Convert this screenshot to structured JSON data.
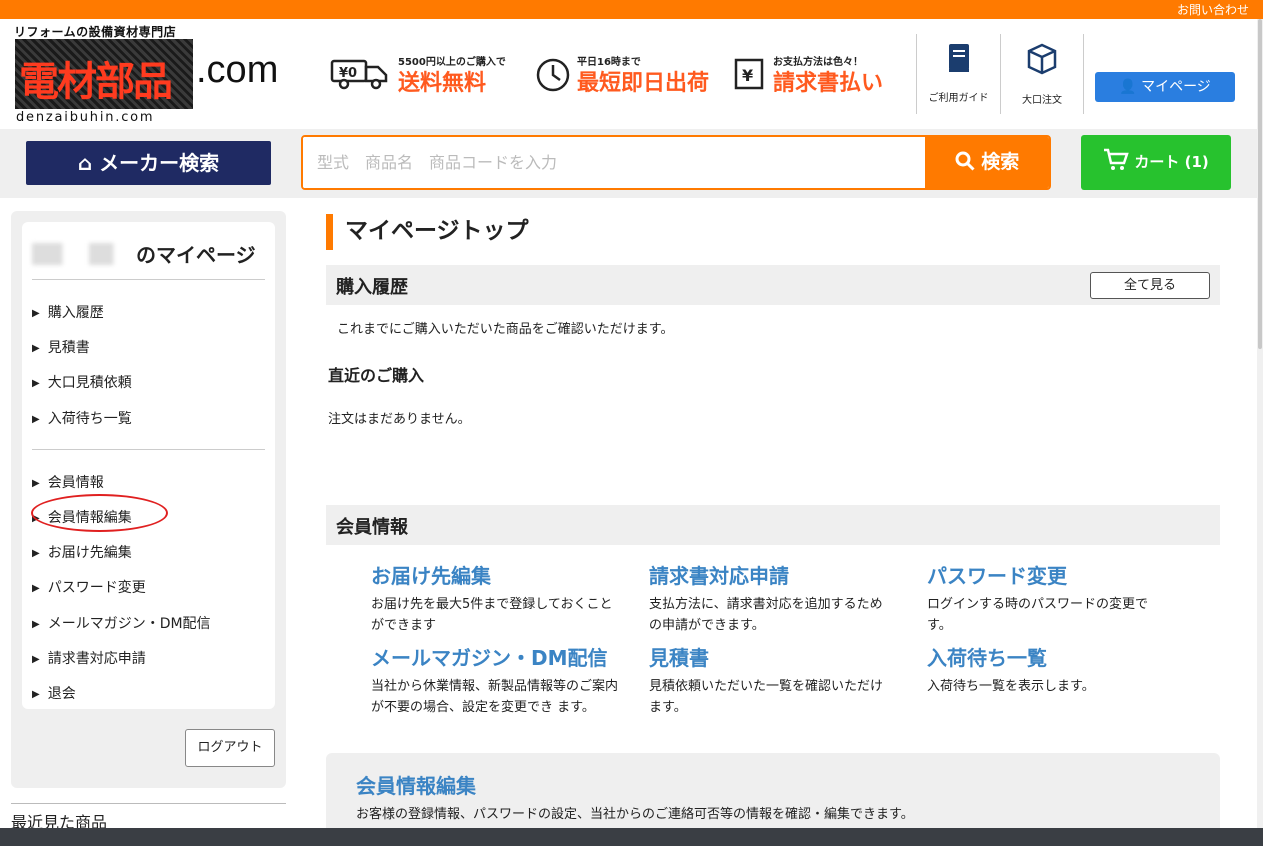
{
  "topbar": {
    "contact": "お問い合わせ"
  },
  "header": {
    "logo_tagline": "リフォームの設備資材専門店",
    "logo_main": "電材部品",
    "logo_dotcom": ".com",
    "logo_sub": "denzaibuhin.com",
    "promos": [
      {
        "icon": "truck-icon",
        "small": "5500円以上のご購入で",
        "big": "送料無料"
      },
      {
        "icon": "clock-icon",
        "small": "平日16時まで",
        "big": "最短即日出荷"
      },
      {
        "icon": "invoice-icon",
        "small": "お支払方法は色々！",
        "big": "請求書払い"
      }
    ],
    "guide_label": "ご利用ガイド",
    "bulk_label": "大口注文",
    "mypage_label": "マイページ"
  },
  "search": {
    "maker_label": "メーカー検索",
    "placeholder": "型式　商品名　商品コードを入力",
    "search_label": "検索",
    "cart_label": "カート (1)"
  },
  "sidebar": {
    "title_suffix": "のマイページ",
    "group1": [
      "購入履歴",
      "見積書",
      "大口見積依頼",
      "入荷待ち一覧"
    ],
    "group2": [
      "会員情報",
      "会員情報編集",
      "お届け先編集",
      "パスワード変更",
      "メールマガジン・DM配信",
      "請求書対応申請",
      "退会"
    ],
    "logout_label": "ログアウト",
    "recent_title": "最近見た商品"
  },
  "main": {
    "title": "マイページトップ",
    "history": {
      "title": "購入履歴",
      "view_all": "全て見る",
      "desc": "これまでにご購入いただいた商品をご確認いただけます。",
      "recent_head": "直近のご購入",
      "empty": "注文はまだありません。"
    },
    "member": {
      "title": "会員情報",
      "links": [
        {
          "title": "お届け先編集",
          "desc": "お届け先を最大5件まで登録しておくことができます"
        },
        {
          "title": "請求書対応申請",
          "desc": "支払方法に、請求書対応を追加するための申請ができます。"
        },
        {
          "title": "パスワード変更",
          "desc": "ログインする時のパスワードの変更です。"
        },
        {
          "title": "メールマガジン・DM配信",
          "desc": "当社から休業情報、新製品情報等のご案内が不要の場合、設定を変更でき ます。"
        },
        {
          "title": "見積書",
          "desc": "見積依頼いただいた一覧を確認いただけます。"
        },
        {
          "title": "入荷待ち一覧",
          "desc": "入荷待ち一覧を表示します。"
        }
      ],
      "edit_card": {
        "title": "会員情報編集",
        "desc": "お客様の登録情報、パスワードの設定、当社からのご連絡可否等の情報を確認・編集できます。"
      }
    }
  },
  "colors": {
    "accent_orange": "#ff7a00",
    "navy": "#1f2a63",
    "blue": "#2a7ee0",
    "green": "#27c22e",
    "link_blue": "#3b84c4"
  }
}
